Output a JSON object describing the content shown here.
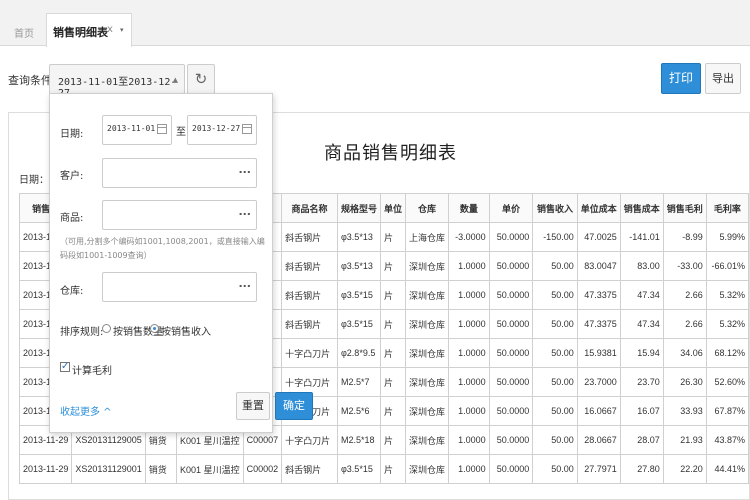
{
  "tabs": {
    "home": "首页",
    "active": "销售明细表",
    "close": "x",
    "menu": "▾"
  },
  "toolbar": {
    "query_label": "查询条件",
    "date_range": "2013-11-01至2013-12-27",
    "date_caret": "▲",
    "refresh_icon": "↻",
    "print": "打印",
    "export": "导出"
  },
  "report": {
    "title": "商品销售明细表",
    "date_prefix": "日期：20",
    "columns": [
      "销售日",
      "",
      "",
      "",
      "",
      "商品名称",
      "规格型号",
      "单位",
      "仓库",
      "数量",
      "单价",
      "销售收入",
      "单位成本",
      "销售成本",
      "销售毛利",
      "毛利率"
    ],
    "rows": [
      [
        "2013-12",
        "",
        "",
        "",
        "",
        "斜舌钢片",
        "φ3.5*13",
        "片",
        "上海仓库",
        "-3.0000",
        "50.0000",
        "-150.00",
        "47.0025",
        "-141.01",
        "-8.99",
        "5.99%"
      ],
      [
        "2013-11",
        "",
        "",
        "",
        "",
        "斜舌钢片",
        "φ3.5*13",
        "片",
        "深圳仓库",
        "1.0000",
        "50.0000",
        "50.00",
        "83.0047",
        "83.00",
        "-33.00",
        "-66.01%"
      ],
      [
        "2013-11",
        "",
        "",
        "",
        "",
        "斜舌钢片",
        "φ3.5*15",
        "片",
        "深圳仓库",
        "1.0000",
        "50.0000",
        "50.00",
        "47.3375",
        "47.34",
        "2.66",
        "5.32%"
      ],
      [
        "2013-11",
        "",
        "",
        "",
        "",
        "斜舌钢片",
        "φ3.5*15",
        "片",
        "深圳仓库",
        "1.0000",
        "50.0000",
        "50.00",
        "47.3375",
        "47.34",
        "2.66",
        "5.32%"
      ],
      [
        "2013-11",
        "",
        "",
        "",
        "",
        "十字凸刀片",
        "φ2.8*9.5",
        "片",
        "深圳仓库",
        "1.0000",
        "50.0000",
        "50.00",
        "15.9381",
        "15.94",
        "34.06",
        "68.12%"
      ],
      [
        "2013-11",
        "",
        "",
        "",
        "",
        "十字凸刀片",
        "M2.5*7",
        "片",
        "深圳仓库",
        "1.0000",
        "50.0000",
        "50.00",
        "23.7000",
        "23.70",
        "26.30",
        "52.60%"
      ],
      [
        "2013-11",
        "",
        "",
        "",
        "",
        "十字凸刀片",
        "M2.5*6",
        "片",
        "深圳仓库",
        "1.0000",
        "50.0000",
        "50.00",
        "16.0667",
        "16.07",
        "33.93",
        "67.87%"
      ],
      [
        "2013-11-29",
        "XS20131129005",
        "销货",
        "K001 星川温控",
        "C00007",
        "十字凸刀片",
        "M2.5*18",
        "片",
        "深圳仓库",
        "1.0000",
        "50.0000",
        "50.00",
        "28.0667",
        "28.07",
        "21.93",
        "43.87%"
      ],
      [
        "2013-11-29",
        "XS20131129001",
        "销货",
        "K001 星川温控",
        "C00002",
        "斜舌钢片",
        "φ3.5*15",
        "片",
        "深圳仓库",
        "1.0000",
        "50.0000",
        "50.00",
        "27.7971",
        "27.80",
        "22.20",
        "44.41%"
      ]
    ]
  },
  "filter": {
    "date_label": "日期:",
    "date_from": "2013-11-01",
    "date_to_sep": "至",
    "date_to": "2013-12-27",
    "customer_label": "客户:",
    "customer_value": "",
    "product_label": "商品:",
    "product_value": "",
    "hint": "（可用,分割多个编码如1001,1008,2001，或直接输入编码段如1001-1009查询）",
    "warehouse_label": "仓库:",
    "warehouse_value": "",
    "sort_label": "排序规则:",
    "sort_by_qty": "按销售数量",
    "sort_by_income": "按销售收入",
    "sort_selected": "income",
    "calc_profit": "计算毛利",
    "calc_profit_checked": true,
    "more": "收起更多 ^",
    "reset": "重置",
    "confirm": "确定",
    "picker_icon": "..."
  },
  "colors": {
    "primary": "#2e8fd8",
    "border": "#cccccc",
    "tab_bg": "#f2f2f2"
  }
}
